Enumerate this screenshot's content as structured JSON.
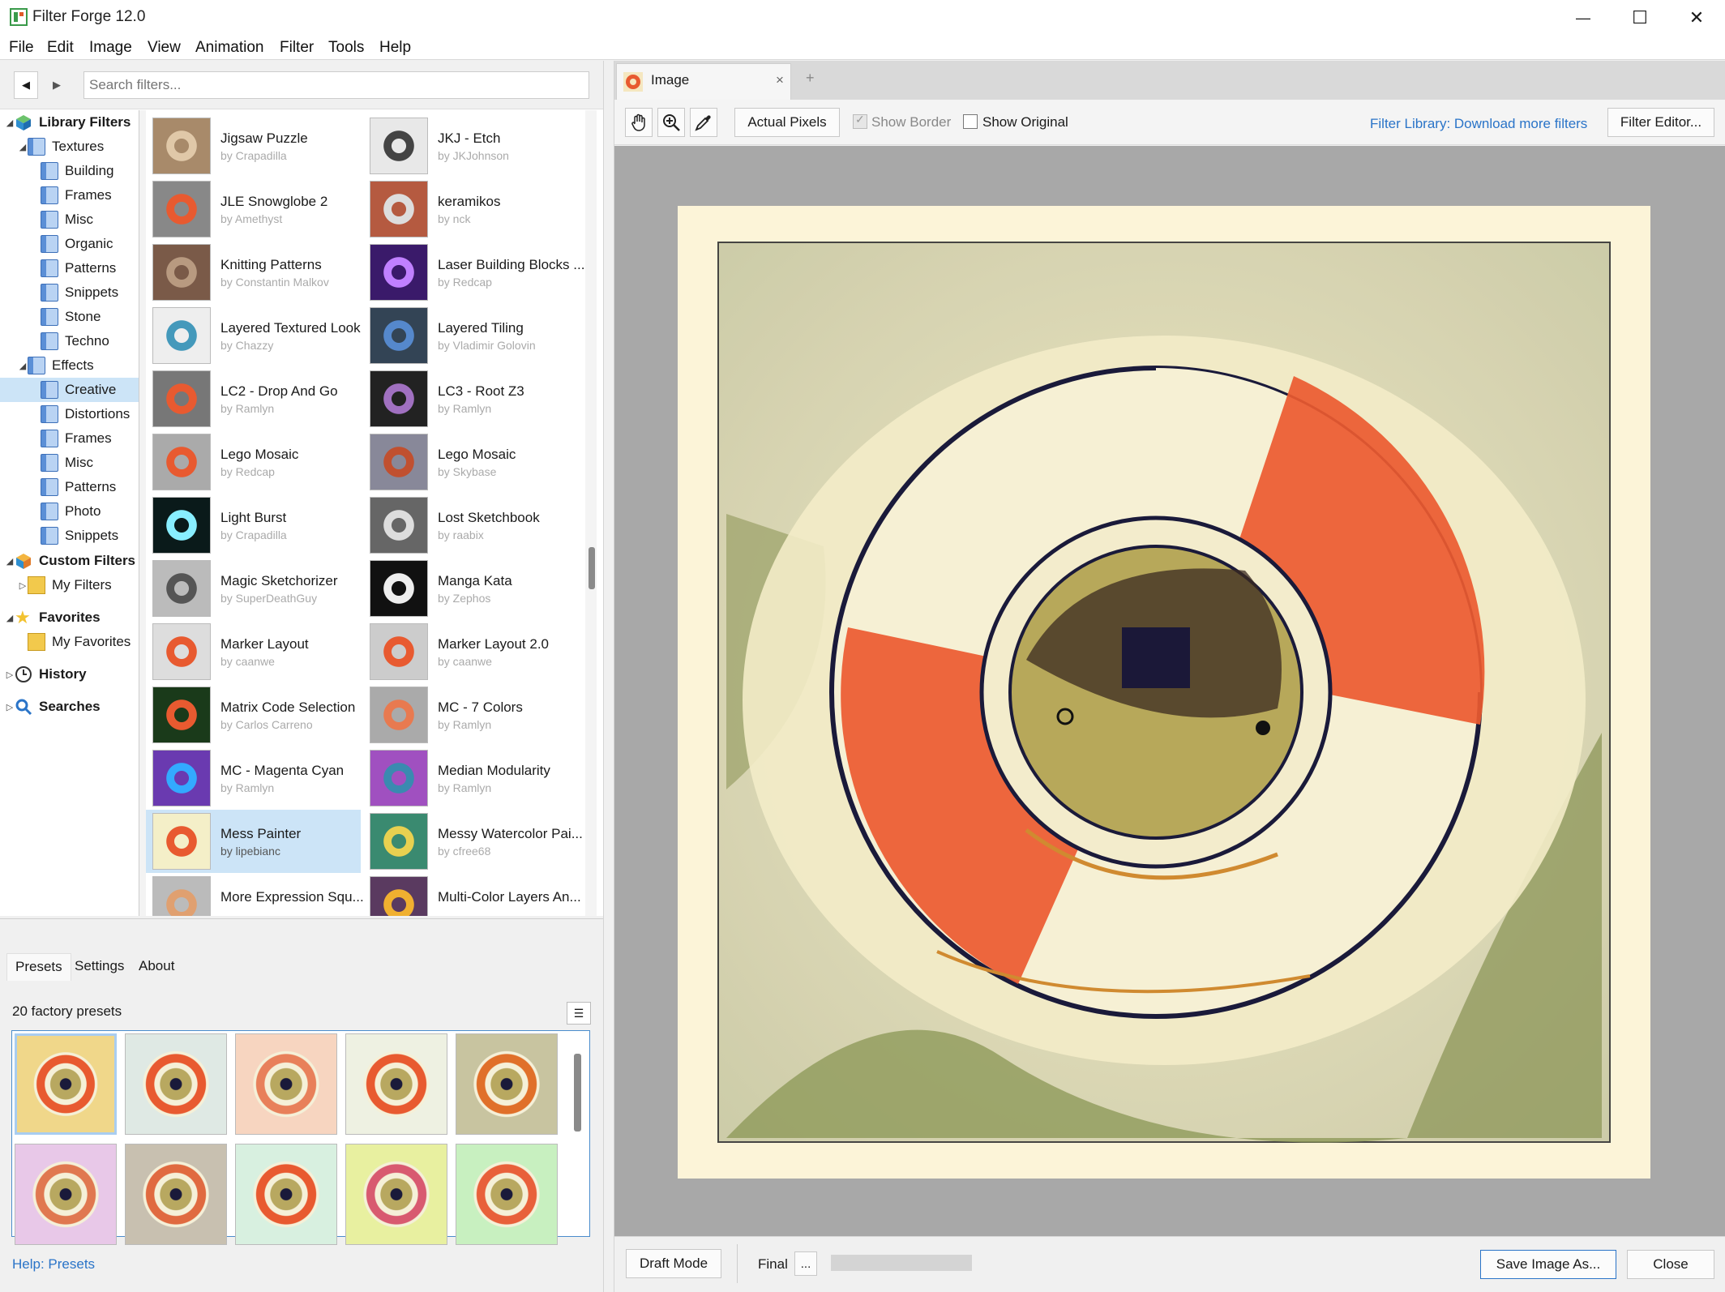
{
  "window": {
    "title": "Filter Forge 12.0",
    "controls": {
      "minimize": "—",
      "maximize": "☐",
      "close": "✕"
    }
  },
  "menu": [
    "File",
    "Edit",
    "Image",
    "View",
    "Animation",
    "Filter",
    "Tools",
    "Help"
  ],
  "search": {
    "placeholder": "Search filters..."
  },
  "tree": {
    "library": "Library Filters",
    "textures": "Textures",
    "texture_items": [
      "Building",
      "Frames",
      "Misc",
      "Organic",
      "Patterns",
      "Snippets",
      "Stone",
      "Techno"
    ],
    "effects": "Effects",
    "effect_items": [
      "Creative",
      "Distortions",
      "Frames",
      "Misc",
      "Patterns",
      "Photo",
      "Snippets"
    ],
    "custom": "Custom Filters",
    "my_filters": "My Filters",
    "favorites": "Favorites",
    "my_favorites": "My Favorites",
    "history": "History",
    "searches": "Searches"
  },
  "filters": [
    {
      "name": "Jigsaw Puzzle",
      "author": "by Crapadilla"
    },
    {
      "name": "JKJ - Etch",
      "author": "by JKJohnson"
    },
    {
      "name": "JLE Snowglobe 2",
      "author": "by Amethyst"
    },
    {
      "name": "keramikos",
      "author": "by nck"
    },
    {
      "name": "Knitting Patterns",
      "author": "by Constantin Malkov"
    },
    {
      "name": "Laser Building Blocks ...",
      "author": "by Redcap"
    },
    {
      "name": "Layered Textured Look",
      "author": "by Chazzy"
    },
    {
      "name": "Layered Tiling",
      "author": "by Vladimir Golovin"
    },
    {
      "name": "LC2 - Drop And Go",
      "author": "by Ramlyn"
    },
    {
      "name": "LC3 - Root Z3",
      "author": "by Ramlyn"
    },
    {
      "name": "Lego Mosaic",
      "author": "by Redcap"
    },
    {
      "name": "Lego Mosaic",
      "author": "by Skybase"
    },
    {
      "name": "Light Burst",
      "author": "by Crapadilla"
    },
    {
      "name": "Lost Sketchbook",
      "author": "by raabix"
    },
    {
      "name": "Magic Sketchorizer",
      "author": "by SuperDeathGuy"
    },
    {
      "name": "Manga Kata",
      "author": "by Zephos"
    },
    {
      "name": "Marker Layout",
      "author": "by caanwe"
    },
    {
      "name": "Marker Layout 2.0",
      "author": "by caanwe"
    },
    {
      "name": "Matrix Code Selection",
      "author": "by Carlos Carreno"
    },
    {
      "name": "MC - 7 Colors",
      "author": "by Ramlyn"
    },
    {
      "name": "MC - Magenta Cyan",
      "author": "by Ramlyn"
    },
    {
      "name": "Median Modularity",
      "author": "by Ramlyn"
    },
    {
      "name": "Mess Painter",
      "author": "by lipebianc"
    },
    {
      "name": "Messy Watercolor Pai...",
      "author": "by cfree68"
    },
    {
      "name": "More Expression Squ...",
      "author": ""
    },
    {
      "name": "Multi-Color Layers An...",
      "author": ""
    }
  ],
  "presets": {
    "tabs": [
      "Presets",
      "Settings",
      "About"
    ],
    "count_label": "20 factory presets",
    "help_link": "Help: Presets"
  },
  "image_tab": {
    "label": "Image",
    "close": "×",
    "add": "+"
  },
  "toolbar": {
    "actual_pixels": "Actual Pixels",
    "show_border": "Show Border",
    "show_original": "Show Original",
    "library_link": "Filter Library: Download more filters",
    "filter_editor": "Filter Editor..."
  },
  "status": {
    "draft_mode": "Draft Mode",
    "final": "Final",
    "more": "...",
    "save": "Save Image As...",
    "close": "Close"
  },
  "colors": {
    "accent": "#2a74c8",
    "selection": "#cce4f7",
    "canvas_bg": "#a8a8a8"
  }
}
